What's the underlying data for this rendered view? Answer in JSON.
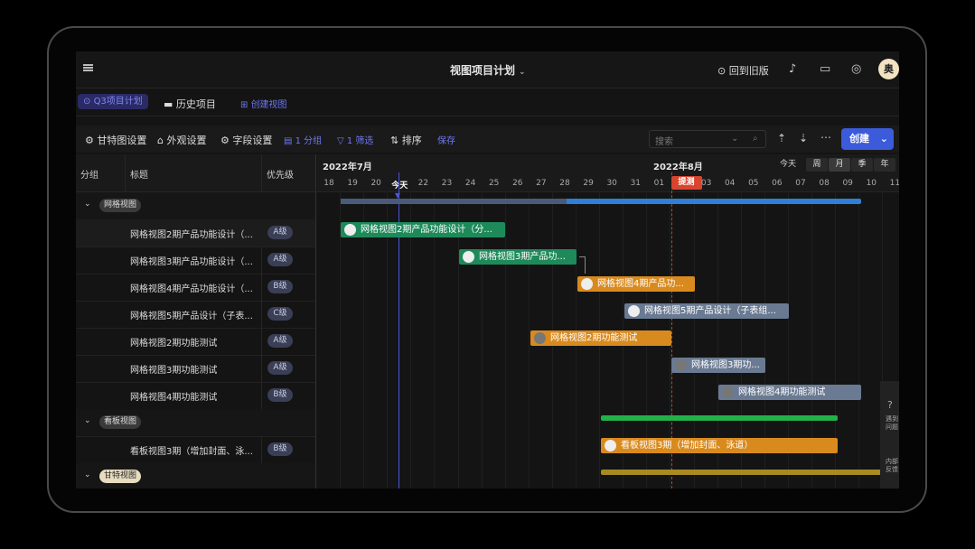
{
  "header": {
    "title": "视图项目计划",
    "old_version": "回到旧版",
    "avatar_text": "奥"
  },
  "tabs": {
    "active": "Q3项目计划",
    "history": "历史项目",
    "create_view": "创建视图"
  },
  "toolbar": {
    "gantt_settings": "甘特图设置",
    "appearance": "外观设置",
    "fields": "字段设置",
    "group": "1 分组",
    "filter": "1 筛选",
    "sort": "排序",
    "save": "保存",
    "search_placeholder": "搜索",
    "create": "创建"
  },
  "grid": {
    "columns": [
      "分组",
      "标题",
      "优先级"
    ],
    "groups": [
      {
        "name": "网格视图",
        "rows": [
          {
            "title": "网格视图2期产品功能设计（...",
            "priority": "A级"
          },
          {
            "title": "网格视图3期产品功能设计（...",
            "priority": "A级"
          },
          {
            "title": "网格视图4期产品功能设计（...",
            "priority": "B级"
          },
          {
            "title": "网格视图5期产品设计（子表...",
            "priority": "C级"
          },
          {
            "title": "网格视图2期功能测试",
            "priority": "A级"
          },
          {
            "title": "网格视图3期功能测试",
            "priority": "A级"
          },
          {
            "title": "网格视图4期功能测试",
            "priority": "B级"
          }
        ]
      },
      {
        "name": "看板视图",
        "rows": [
          {
            "title": "看板视图3期（增加封面、泳...",
            "priority": "B级"
          }
        ]
      },
      {
        "name": "甘特视图",
        "rows": []
      }
    ]
  },
  "timeline": {
    "month1": "2022年7月",
    "month2": "2022年8月",
    "days": [
      "18",
      "19",
      "20",
      "今天",
      "22",
      "23",
      "24",
      "25",
      "26",
      "27",
      "28",
      "29",
      "30",
      "31",
      "01",
      "提测",
      "03",
      "04",
      "05",
      "06",
      "07",
      "08",
      "09",
      "10",
      "11"
    ],
    "today_label": "今天",
    "milestone": "提测",
    "zoom": {
      "today": "今天",
      "week": "周",
      "month": "月",
      "quarter": "季",
      "year": "年"
    },
    "bars": [
      "网格视图2期产品功能设计（分...",
      "网格视图3期产品功...",
      "网格视图4期产品功...",
      "网格视图5期产品设计（子表组...",
      "网格视图2期功能测试",
      "网格视图3期功...",
      "网格视图4期功能测试",
      "看板视图3期（增加封面、泳道）"
    ]
  },
  "side_panel": {
    "line1": "遇到问题",
    "line2": "内部反馈"
  }
}
